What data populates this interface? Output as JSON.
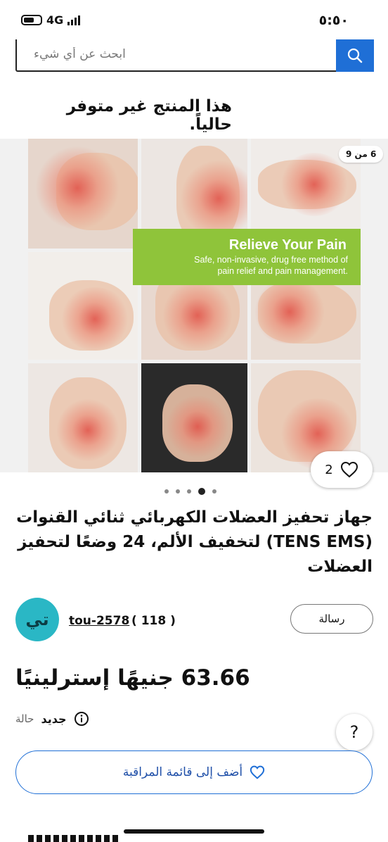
{
  "status_bar": {
    "time": "٥:٥٠",
    "network": "4G"
  },
  "search": {
    "placeholder": "ابحث عن أي شيء"
  },
  "availability_text": "هذا المنتج غير متوفر حالياً.",
  "gallery": {
    "counter": "6 من 9",
    "banner_title": "Relieve Your Pain",
    "banner_line1": "Safe, non-invasive, drug free method of",
    "banner_line2": "pain relief and pain management.",
    "favorite_count": "2",
    "page_dots": 5,
    "active_dot": 4
  },
  "product": {
    "title": "جهاز تحفيز العضلات الكهربائي ثنائي القنوات (TENS EMS) لتخفيف الألم، 24 وضعًا لتحفيز العضلات",
    "price": "63.66 جنيهًا إسترلينيًا",
    "condition_label": "حالة",
    "condition_value": "جديد"
  },
  "seller": {
    "avatar_text": "تي",
    "name": "tou-2578",
    "feedback": "( 118 )",
    "message_button": "رسالة"
  },
  "help_label": "?",
  "watchlist_button": "أضف إلى قائمة المراقبة",
  "colors": {
    "accent": "#1f6fd6",
    "banner": "#8fc43a",
    "avatar": "#2ab7c5"
  }
}
